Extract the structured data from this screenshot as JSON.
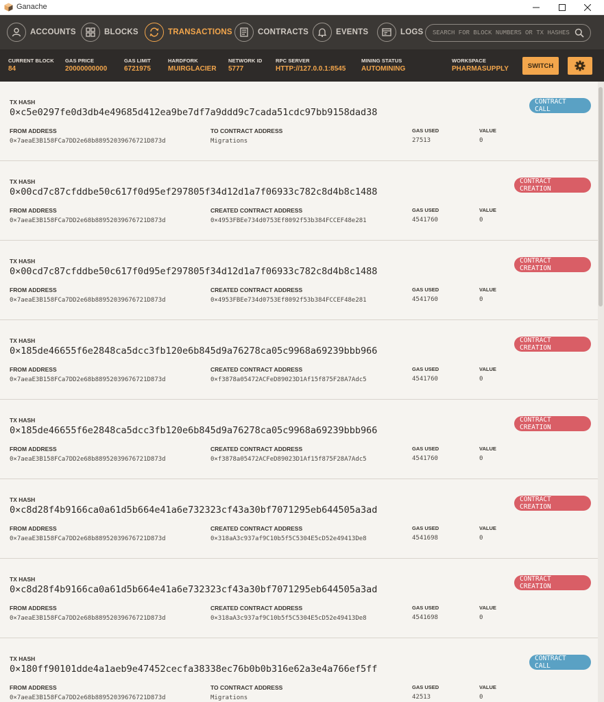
{
  "window": {
    "title": "Ganache"
  },
  "nav": {
    "items": [
      {
        "label": "ACCOUNTS",
        "icon": "accounts-icon"
      },
      {
        "label": "BLOCKS",
        "icon": "blocks-icon"
      },
      {
        "label": "TRANSACTIONS",
        "icon": "transactions-icon",
        "active": true
      },
      {
        "label": "CONTRACTS",
        "icon": "contracts-icon"
      },
      {
        "label": "EVENTS",
        "icon": "events-icon"
      },
      {
        "label": "LOGS",
        "icon": "logs-icon"
      }
    ],
    "search_placeholder": "SEARCH FOR BLOCK NUMBERS OR TX HASHES"
  },
  "status": {
    "current_block_label": "CURRENT BLOCK",
    "current_block": "84",
    "gas_price_label": "GAS PRICE",
    "gas_price": "20000000000",
    "gas_limit_label": "GAS LIMIT",
    "gas_limit": "6721975",
    "hardfork_label": "HARDFORK",
    "hardfork": "MUIRGLACIER",
    "network_id_label": "NETWORK ID",
    "network_id": "5777",
    "rpc_server_label": "RPC SERVER",
    "rpc_server": "HTTP://127.0.0.1:8545",
    "mining_status_label": "MINING STATUS",
    "mining_status": "AUTOMINING",
    "workspace_label": "WORKSPACE",
    "workspace": "PHARMASUPPLY",
    "switch_label": "SWITCH"
  },
  "labels": {
    "tx_hash": "TX HASH",
    "from_address": "FROM ADDRESS",
    "gas_used": "GAS USED",
    "value": "VALUE"
  },
  "colors": {
    "accent": "#f3a64c",
    "call": "#5aa1c4",
    "creation": "#d95e66"
  },
  "transactions": [
    {
      "hash": "0×c5e0297fe0d3db4e49685d412ea9be7df7a9ddd9c7cada51cdc97bb9158dad38",
      "from": "0×7aeaE3B158FCa7DD2e68b88952039676721D873d",
      "to_label": "TO CONTRACT ADDRESS",
      "to": "Migrations",
      "gas_used": "27513",
      "value": "0",
      "type": "CONTRACT CALL"
    },
    {
      "hash": "0×00cd7c87cfddbe50c617f0d95ef297805f34d12d1a7f06933c782c8d4b8c1488",
      "from": "0×7aeaE3B158FCa7DD2e68b88952039676721D873d",
      "to_label": "CREATED CONTRACT ADDRESS",
      "to": "0×4953FBEe734d0753Ef8092f53b384FCCEF48e281",
      "gas_used": "4541760",
      "value": "0",
      "type": "CONTRACT CREATION"
    },
    {
      "hash": "0×00cd7c87cfddbe50c617f0d95ef297805f34d12d1a7f06933c782c8d4b8c1488",
      "from": "0×7aeaE3B158FCa7DD2e68b88952039676721D873d",
      "to_label": "CREATED CONTRACT ADDRESS",
      "to": "0×4953FBEe734d0753Ef8092f53b384FCCEF48e281",
      "gas_used": "4541760",
      "value": "0",
      "type": "CONTRACT CREATION"
    },
    {
      "hash": "0×185de46655f6e2848ca5dcc3fb120e6b845d9a76278ca05c9968a69239bbb966",
      "from": "0×7aeaE3B158FCa7DD2e68b88952039676721D873d",
      "to_label": "CREATED CONTRACT ADDRESS",
      "to": "0×f3878a05472ACFeD89023D1Af15f875F28A7Adc5",
      "gas_used": "4541760",
      "value": "0",
      "type": "CONTRACT CREATION"
    },
    {
      "hash": "0×185de46655f6e2848ca5dcc3fb120e6b845d9a76278ca05c9968a69239bbb966",
      "from": "0×7aeaE3B158FCa7DD2e68b88952039676721D873d",
      "to_label": "CREATED CONTRACT ADDRESS",
      "to": "0×f3878a05472ACFeD89023D1Af15f875F28A7Adc5",
      "gas_used": "4541760",
      "value": "0",
      "type": "CONTRACT CREATION"
    },
    {
      "hash": "0×c8d28f4b9166ca0a61d5b664e41a6e732323cf43a30bf7071295eb644505a3ad",
      "from": "0×7aeaE3B158FCa7DD2e68b88952039676721D873d",
      "to_label": "CREATED CONTRACT ADDRESS",
      "to": "0×318aA3c937af9C10b5f5C5304E5cD52e49413De8",
      "gas_used": "4541698",
      "value": "0",
      "type": "CONTRACT CREATION"
    },
    {
      "hash": "0×c8d28f4b9166ca0a61d5b664e41a6e732323cf43a30bf7071295eb644505a3ad",
      "from": "0×7aeaE3B158FCa7DD2e68b88952039676721D873d",
      "to_label": "CREATED CONTRACT ADDRESS",
      "to": "0×318aA3c937af9C10b5f5C5304E5cD52e49413De8",
      "gas_used": "4541698",
      "value": "0",
      "type": "CONTRACT CREATION"
    },
    {
      "hash": "0×180ff90101dde4a1aeb9e47452cecfa38338ec76b0b0b316e62a3e4a766ef5ff",
      "from": "0×7aeaE3B158FCa7DD2e68b88952039676721D873d",
      "to_label": "TO CONTRACT ADDRESS",
      "to": "Migrations",
      "gas_used": "42513",
      "value": "0",
      "type": "CONTRACT CALL"
    }
  ]
}
